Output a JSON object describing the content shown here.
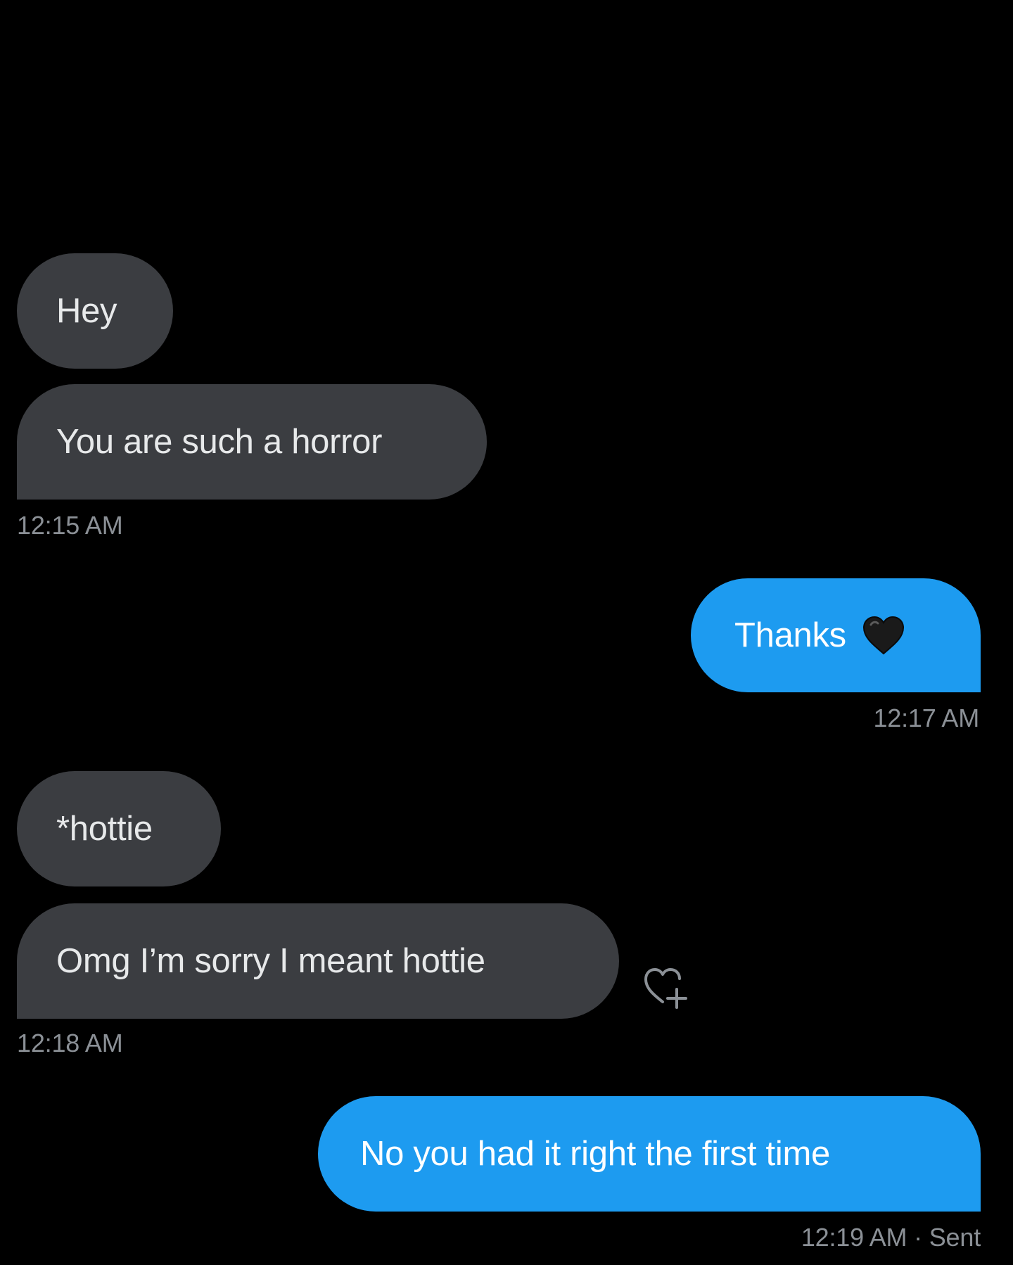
{
  "conversation": {
    "messages": [
      {
        "text": "Hey",
        "from": "them"
      },
      {
        "text": "You are such a horror",
        "from": "them"
      },
      {
        "text": "Thanks",
        "emoji": "black-heart",
        "from": "me"
      },
      {
        "text": "*hottie",
        "from": "them"
      },
      {
        "text": "Omg I’m sorry I meant hottie",
        "from": "them"
      },
      {
        "text": "No you had it right the first time",
        "from": "me"
      }
    ],
    "timestamps": {
      "t1": "12:15 AM",
      "t2": "12:17 AM",
      "t3": "12:18 AM",
      "t4": "12:19 AM · Sent"
    }
  },
  "colors": {
    "background": "#000000",
    "received_bubble": "#3b3d41",
    "sent_bubble": "#1d9bf0",
    "timestamp": "#8b9096"
  },
  "icons": {
    "emoji_in_thanks": "black-heart-icon",
    "reaction": "add-reaction-heart-icon"
  }
}
